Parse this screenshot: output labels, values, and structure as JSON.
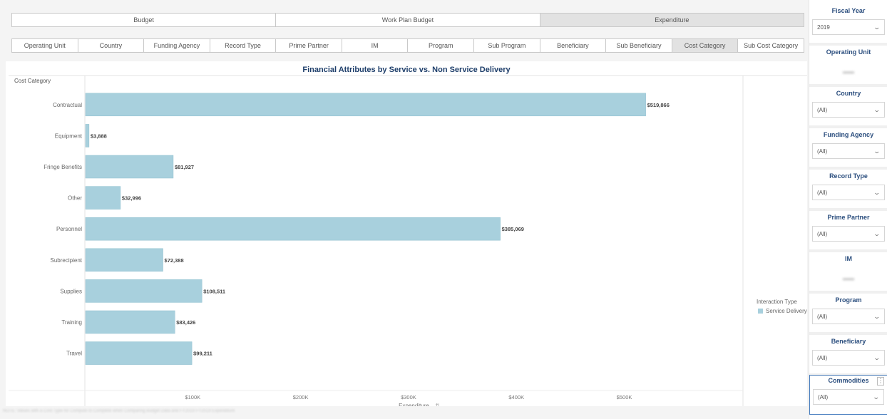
{
  "top_tabs": [
    "Budget",
    "Work Plan Budget",
    "Expenditure"
  ],
  "sub_tabs": [
    "Operating Unit",
    "Country",
    "Funding Agency",
    "Record Type",
    "Prime Partner",
    "IM",
    "Program",
    "Sub Program",
    "Beneficiary",
    "Sub Beneficiary",
    "Cost Category",
    "Sub Cost Category"
  ],
  "chart_data": {
    "type": "bar",
    "orientation": "horizontal",
    "title": "Financial Attributes by Service vs. Non Service Delivery",
    "row_header": "Cost Category",
    "categories": [
      "Contractual",
      "Equipment",
      "Fringe Benefits",
      "Other",
      "Personnel",
      "Subrecipient",
      "Supplies",
      "Training",
      "Travel"
    ],
    "series": [
      {
        "name": "Service Delivery",
        "values": [
          519866,
          3888,
          81927,
          32996,
          385069,
          72388,
          108511,
          83426,
          99211
        ],
        "color": "#a8d0dd"
      }
    ],
    "value_labels": [
      "$519,866",
      "$3,888",
      "$81,927",
      "$32,996",
      "$385,069",
      "$72,388",
      "$108,511",
      "$83,426",
      "$99,211"
    ],
    "xlabel": "Expenditure",
    "xlabel_icon": "sort-icon",
    "xticks": [
      "$100K",
      "$200K",
      "$300K",
      "$400K",
      "$500K"
    ],
    "xlim": [
      0,
      610000
    ],
    "legend": {
      "title": "Interaction Type",
      "placement": "right"
    },
    "grid": false
  },
  "filters": [
    {
      "title": "Fiscal Year",
      "value": "2019"
    },
    {
      "title": "Operating Unit",
      "value": null
    },
    {
      "title": "Country",
      "value": "(All)"
    },
    {
      "title": "Funding Agency",
      "value": "(All)"
    },
    {
      "title": "Record Type",
      "value": "(All)"
    },
    {
      "title": "Prime Partner",
      "value": "(All)"
    },
    {
      "title": "IM",
      "value": null
    },
    {
      "title": "Program",
      "value": "(All)"
    },
    {
      "title": "Beneficiary",
      "value": "(All)"
    },
    {
      "title": "Commodities",
      "value": "(All)"
    }
  ],
  "commodities_more": "⋮",
  "accent_color": "#2b4e7e",
  "footer_note": "NOTE: Values with a Cost Type for Compute to Complete when Comparing Budget Data and FY2019 FY2019 Expenditure"
}
